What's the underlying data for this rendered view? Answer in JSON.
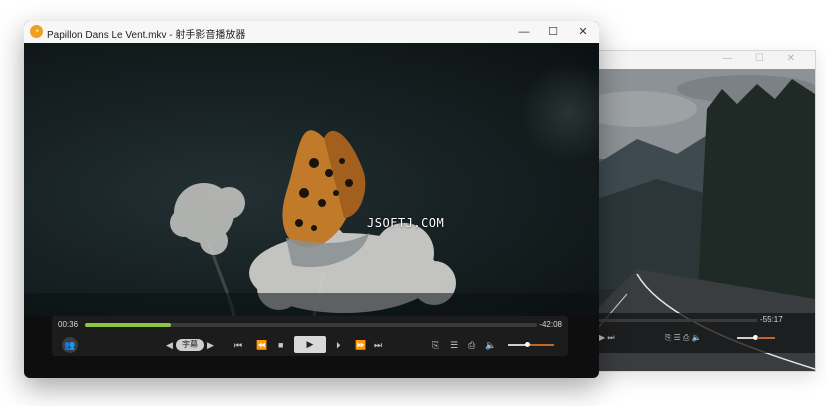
{
  "main_window": {
    "title": "Papillon Dans Le Vent.mkv - 射手影音播放器",
    "app_icon": "shooter-player-logo",
    "buttons": {
      "minimize": "—",
      "maximize": "☐",
      "close": "✕"
    }
  },
  "video": {
    "overlay_text": "JSOFTJ.COM"
  },
  "controls": {
    "time_elapsed": "00:36",
    "time_remaining": "-42:08",
    "progress": 0.19,
    "subtitle_label": "字幕",
    "volume_level": 0.42,
    "accent_color": "#8cc63f",
    "icons": [
      "user-icon",
      "prev-subtitle-icon",
      "next-subtitle-icon",
      "skip-back-icon",
      "rewind-icon",
      "stop-icon",
      "play-icon",
      "step-forward-icon",
      "fast-forward-icon",
      "skip-forward-icon",
      "copy-icon",
      "playlist-icon",
      "paste-icon",
      "volume-icon"
    ]
  },
  "background_window": {
    "time_remaining": "-55:17"
  }
}
